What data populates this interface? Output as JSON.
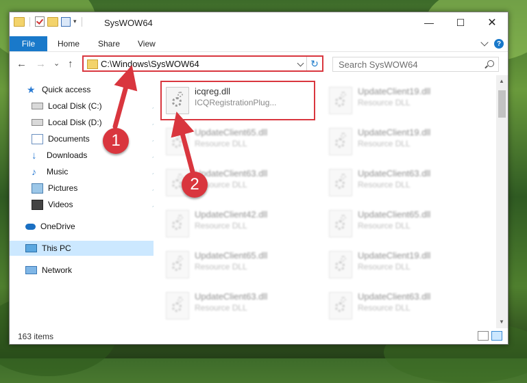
{
  "window": {
    "title": "SysWOW64"
  },
  "ribbon": {
    "tabs": [
      "File",
      "Home",
      "Share",
      "View"
    ],
    "help": "?"
  },
  "address": {
    "path": "C:\\Windows\\SysWOW64",
    "refresh_glyph": "↻"
  },
  "search": {
    "placeholder": "Search SysWOW64"
  },
  "nav": {
    "back": "←",
    "forward": "→",
    "recent": "⌄",
    "up": "↑"
  },
  "sidebar": {
    "items": [
      {
        "label": "Quick access",
        "icon": "star-icon"
      },
      {
        "label": "Local Disk (C:)",
        "icon": "drive-icon"
      },
      {
        "label": "Local Disk (D:)",
        "icon": "drive-icon"
      },
      {
        "label": "Documents",
        "icon": "documents-icon"
      },
      {
        "label": "Downloads",
        "icon": "download-icon"
      },
      {
        "label": "Music",
        "icon": "music-icon"
      },
      {
        "label": "Pictures",
        "icon": "pictures-icon"
      },
      {
        "label": "Videos",
        "icon": "videos-icon"
      },
      {
        "label": "OneDrive",
        "icon": "cloud-icon"
      },
      {
        "label": "This PC",
        "icon": "computer-icon"
      },
      {
        "label": "Network",
        "icon": "network-icon"
      }
    ]
  },
  "files": [
    {
      "name": "icqreg.dll",
      "desc": "ICQRegistrationPlug..."
    },
    {
      "name": "UpdateClient19.dll",
      "desc": "Resource DLL"
    },
    {
      "name": "UpdateClient65.dll",
      "desc": "Resource DLL"
    },
    {
      "name": "UpdateClient19.dll",
      "desc": "Resource DLL"
    },
    {
      "name": "UpdateClient63.dll",
      "desc": "Resource DLL"
    },
    {
      "name": "UpdateClient63.dll",
      "desc": "Resource DLL"
    },
    {
      "name": "UpdateClient42.dll",
      "desc": "Resource DLL"
    },
    {
      "name": "UpdateClient65.dll",
      "desc": "Resource DLL"
    },
    {
      "name": "UpdateClient65.dll",
      "desc": "Resource DLL"
    },
    {
      "name": "UpdateClient19.dll",
      "desc": "Resource DLL"
    },
    {
      "name": "UpdateClient63.dll",
      "desc": "Resource DLL"
    },
    {
      "name": "UpdateClient63.dll",
      "desc": "Resource DLL"
    }
  ],
  "status": {
    "count": "163 items"
  },
  "callouts": {
    "one": "1",
    "two": "2"
  },
  "colors": {
    "accent": "#1979ca",
    "highlight": "#d9363e",
    "selected": "#cce8ff"
  }
}
